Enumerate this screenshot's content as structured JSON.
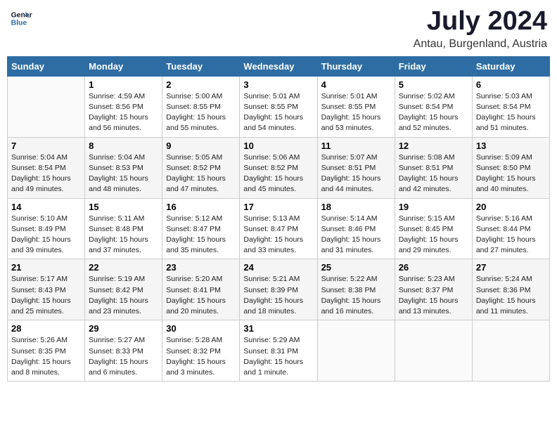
{
  "header": {
    "logo_line1": "General",
    "logo_line2": "Blue",
    "month": "July 2024",
    "location": "Antau, Burgenland, Austria"
  },
  "columns": [
    "Sunday",
    "Monday",
    "Tuesday",
    "Wednesday",
    "Thursday",
    "Friday",
    "Saturday"
  ],
  "weeks": [
    [
      {
        "day": "",
        "info": ""
      },
      {
        "day": "1",
        "info": "Sunrise: 4:59 AM\nSunset: 8:56 PM\nDaylight: 15 hours\nand 56 minutes."
      },
      {
        "day": "2",
        "info": "Sunrise: 5:00 AM\nSunset: 8:55 PM\nDaylight: 15 hours\nand 55 minutes."
      },
      {
        "day": "3",
        "info": "Sunrise: 5:01 AM\nSunset: 8:55 PM\nDaylight: 15 hours\nand 54 minutes."
      },
      {
        "day": "4",
        "info": "Sunrise: 5:01 AM\nSunset: 8:55 PM\nDaylight: 15 hours\nand 53 minutes."
      },
      {
        "day": "5",
        "info": "Sunrise: 5:02 AM\nSunset: 8:54 PM\nDaylight: 15 hours\nand 52 minutes."
      },
      {
        "day": "6",
        "info": "Sunrise: 5:03 AM\nSunset: 8:54 PM\nDaylight: 15 hours\nand 51 minutes."
      }
    ],
    [
      {
        "day": "7",
        "info": "Sunrise: 5:04 AM\nSunset: 8:54 PM\nDaylight: 15 hours\nand 49 minutes."
      },
      {
        "day": "8",
        "info": "Sunrise: 5:04 AM\nSunset: 8:53 PM\nDaylight: 15 hours\nand 48 minutes."
      },
      {
        "day": "9",
        "info": "Sunrise: 5:05 AM\nSunset: 8:52 PM\nDaylight: 15 hours\nand 47 minutes."
      },
      {
        "day": "10",
        "info": "Sunrise: 5:06 AM\nSunset: 8:52 PM\nDaylight: 15 hours\nand 45 minutes."
      },
      {
        "day": "11",
        "info": "Sunrise: 5:07 AM\nSunset: 8:51 PM\nDaylight: 15 hours\nand 44 minutes."
      },
      {
        "day": "12",
        "info": "Sunrise: 5:08 AM\nSunset: 8:51 PM\nDaylight: 15 hours\nand 42 minutes."
      },
      {
        "day": "13",
        "info": "Sunrise: 5:09 AM\nSunset: 8:50 PM\nDaylight: 15 hours\nand 40 minutes."
      }
    ],
    [
      {
        "day": "14",
        "info": "Sunrise: 5:10 AM\nSunset: 8:49 PM\nDaylight: 15 hours\nand 39 minutes."
      },
      {
        "day": "15",
        "info": "Sunrise: 5:11 AM\nSunset: 8:48 PM\nDaylight: 15 hours\nand 37 minutes."
      },
      {
        "day": "16",
        "info": "Sunrise: 5:12 AM\nSunset: 8:47 PM\nDaylight: 15 hours\nand 35 minutes."
      },
      {
        "day": "17",
        "info": "Sunrise: 5:13 AM\nSunset: 8:47 PM\nDaylight: 15 hours\nand 33 minutes."
      },
      {
        "day": "18",
        "info": "Sunrise: 5:14 AM\nSunset: 8:46 PM\nDaylight: 15 hours\nand 31 minutes."
      },
      {
        "day": "19",
        "info": "Sunrise: 5:15 AM\nSunset: 8:45 PM\nDaylight: 15 hours\nand 29 minutes."
      },
      {
        "day": "20",
        "info": "Sunrise: 5:16 AM\nSunset: 8:44 PM\nDaylight: 15 hours\nand 27 minutes."
      }
    ],
    [
      {
        "day": "21",
        "info": "Sunrise: 5:17 AM\nSunset: 8:43 PM\nDaylight: 15 hours\nand 25 minutes."
      },
      {
        "day": "22",
        "info": "Sunrise: 5:19 AM\nSunset: 8:42 PM\nDaylight: 15 hours\nand 23 minutes."
      },
      {
        "day": "23",
        "info": "Sunrise: 5:20 AM\nSunset: 8:41 PM\nDaylight: 15 hours\nand 20 minutes."
      },
      {
        "day": "24",
        "info": "Sunrise: 5:21 AM\nSunset: 8:39 PM\nDaylight: 15 hours\nand 18 minutes."
      },
      {
        "day": "25",
        "info": "Sunrise: 5:22 AM\nSunset: 8:38 PM\nDaylight: 15 hours\nand 16 minutes."
      },
      {
        "day": "26",
        "info": "Sunrise: 5:23 AM\nSunset: 8:37 PM\nDaylight: 15 hours\nand 13 minutes."
      },
      {
        "day": "27",
        "info": "Sunrise: 5:24 AM\nSunset: 8:36 PM\nDaylight: 15 hours\nand 11 minutes."
      }
    ],
    [
      {
        "day": "28",
        "info": "Sunrise: 5:26 AM\nSunset: 8:35 PM\nDaylight: 15 hours\nand 8 minutes."
      },
      {
        "day": "29",
        "info": "Sunrise: 5:27 AM\nSunset: 8:33 PM\nDaylight: 15 hours\nand 6 minutes."
      },
      {
        "day": "30",
        "info": "Sunrise: 5:28 AM\nSunset: 8:32 PM\nDaylight: 15 hours\nand 3 minutes."
      },
      {
        "day": "31",
        "info": "Sunrise: 5:29 AM\nSunset: 8:31 PM\nDaylight: 15 hours\nand 1 minute."
      },
      {
        "day": "",
        "info": ""
      },
      {
        "day": "",
        "info": ""
      },
      {
        "day": "",
        "info": ""
      }
    ]
  ]
}
